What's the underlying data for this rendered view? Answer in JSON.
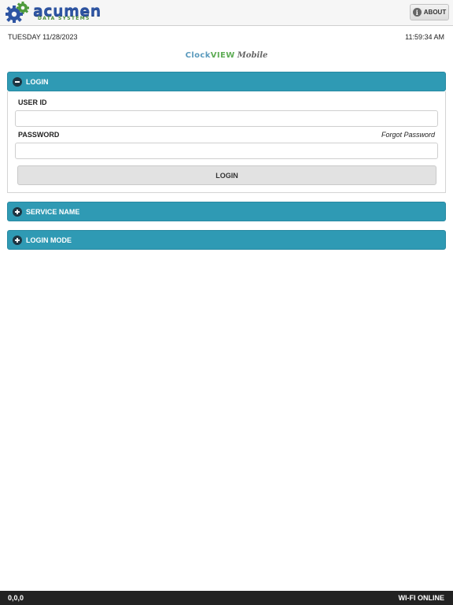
{
  "header": {
    "logo_text": "acumen",
    "logo_subtext": "DATA SYSTEMS",
    "about_icon": "info-icon",
    "about_label": "ABOUT"
  },
  "datetime": {
    "date": "TUESDAY 11/28/2023",
    "time": "11:59:34 AM"
  },
  "brand": {
    "clock": "Clock",
    "view": "VIEW",
    "mobile": "Mobile"
  },
  "login_section": {
    "title": "LOGIN",
    "icon": "minus-circle-icon",
    "user_id_label": "USER ID",
    "user_id_value": "",
    "password_label": "PASSWORD",
    "password_value": "",
    "forgot_password": "Forgot Password",
    "login_button": "LOGIN"
  },
  "service_section": {
    "title": "SERVICE NAME",
    "icon": "plus-circle-icon"
  },
  "mode_section": {
    "title": "LOGIN MODE",
    "icon": "plus-circle-icon"
  },
  "footer": {
    "coords": "0,0,0",
    "status": "WI-FI ONLINE"
  },
  "colors": {
    "accent": "#2f9ab4",
    "footer_bg": "#222222",
    "logo_blue": "#2e55a3",
    "logo_green": "#4a8f3a"
  }
}
